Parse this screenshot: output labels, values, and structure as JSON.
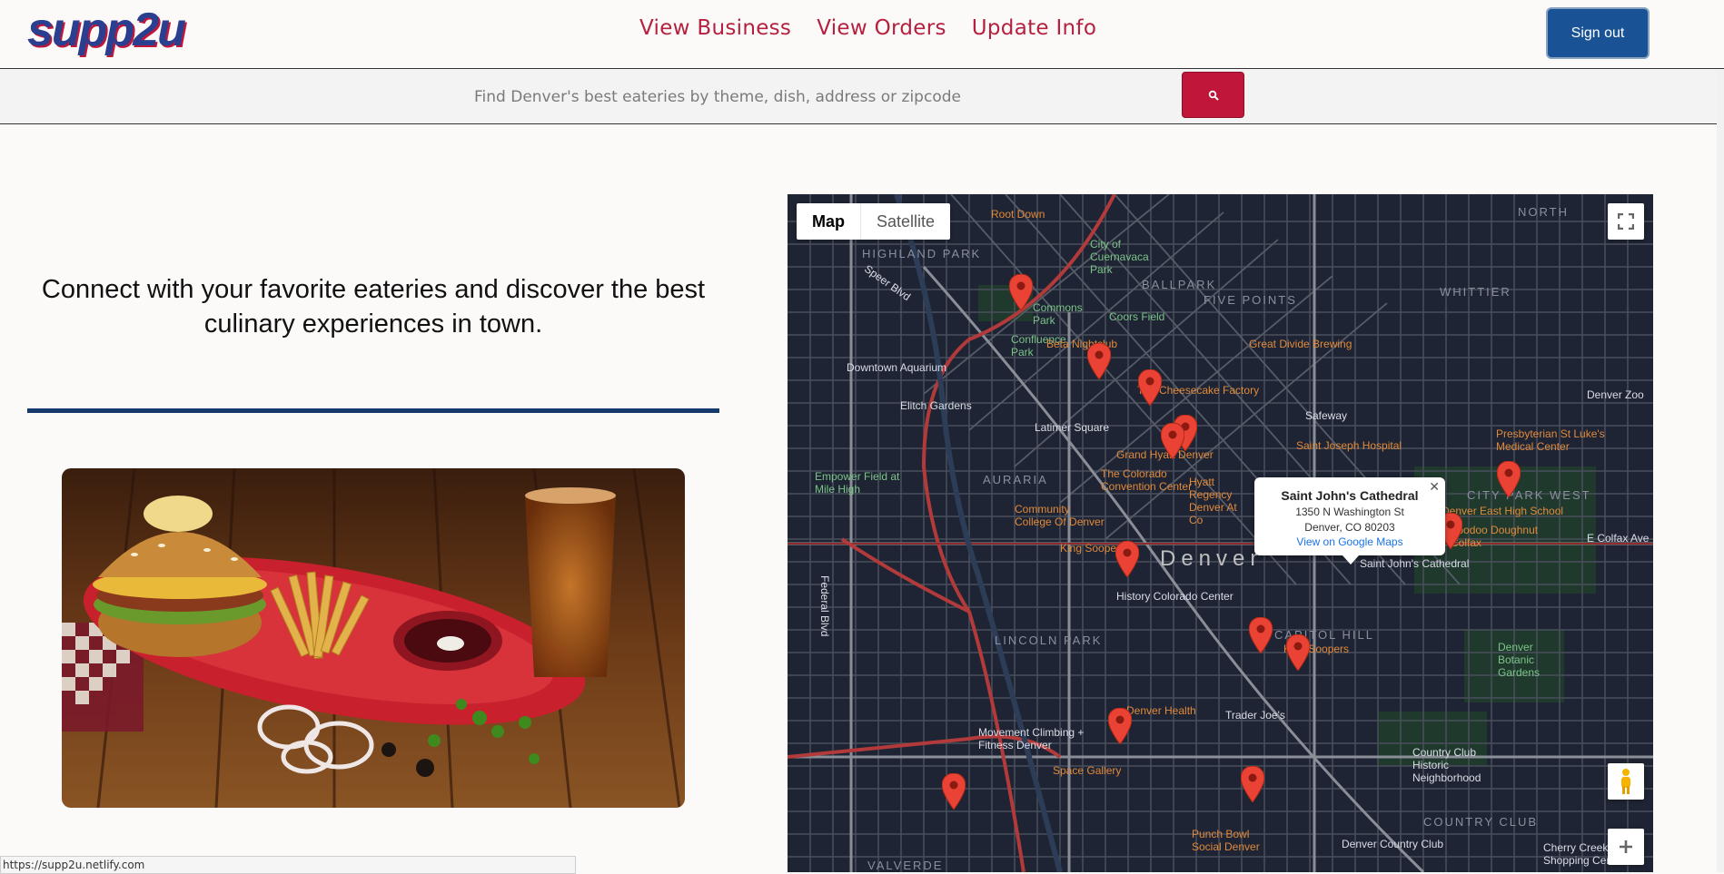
{
  "header": {
    "logo_text": "supp2u",
    "nav": [
      "View Business",
      "View Orders",
      "Update Info"
    ],
    "signout_label": "Sign out"
  },
  "search": {
    "placeholder": "Find Denver's best eateries by theme, dish, address or zipcode"
  },
  "hero": {
    "tagline": "Connect with your favorite eateries and discover the best culinary experiences in town."
  },
  "map": {
    "toggle": {
      "map": "Map",
      "satellite": "Satellite"
    },
    "info": {
      "title": "Saint John's Cathedral",
      "line1": "1350 N Washington St",
      "line2": "Denver, CO 80203",
      "link": "View on Google Maps"
    },
    "labels": {
      "root_down": "Root Down",
      "highland_park": "HIGHLAND PARK",
      "city_cuernavaca": "City of Cuernavaca Park",
      "ballpark": "BALLPARK",
      "five_points": "FIVE POINTS",
      "whittier": "WHITTIER",
      "north": "NORTH",
      "commons_park": "Commons Park",
      "coors_field": "Coors Field",
      "confluence_park": "Confluence Park",
      "beta_nightclub": "Beta Nightclub",
      "great_divide": "Great Divide Brewing",
      "downtown_aquarium": "Downtown Aquarium",
      "cheesecake": "The Cheesecake Factory",
      "elitch": "Elitch Gardens",
      "safeway": "Safeway",
      "latimer": "Latimer Square",
      "grand_hyatt": "Grand Hyatt Denver",
      "st_joseph": "Saint Joseph Hospital",
      "presbyterian": "Presbyterian St Luke's Medical Center",
      "denver_zoo": "Denver Zoo",
      "auraria": "AURARIA",
      "convention_center": "The Colorado Convention Center",
      "hyatt_regency": "Hyatt Regency Denver At Co",
      "city_park_west": "CITY PARK WEST",
      "east_high": "Denver East High School",
      "voodoo": "Voodoo Doughnut Colfax",
      "empower": "Empower Field at Mile High",
      "ccd": "Community College Of Denver",
      "king_soopers1": "King Soopers",
      "denver": "Denver",
      "st_johns": "Saint John's Cathedral",
      "history_colorado": "History Colorado Center",
      "lincoln_park": "LINCOLN PARK",
      "capitol_hill": "CAPITOL HILL",
      "king_soopers2": "King Soopers",
      "botanic": "Denver Botanic Gardens",
      "denver_health": "Denver Health",
      "trader_joes": "Trader Joe's",
      "movement": "Movement Climbing + Fitness Denver",
      "country_club_hist": "Country Club Historic Neighborhood",
      "space_gallery": "Space Gallery",
      "country_club": "COUNTRY CLUB",
      "punch_bowl": "Punch Bowl Social Denver",
      "denver_cc": "Denver Country Club",
      "cherry_creek": "Cherry Creek Shopping Center",
      "valverde": "VALVERDE",
      "federal_blvd": "Federal Blvd",
      "speer_blvd": "Speer Blvd",
      "colfax": "E Colfax Ave"
    }
  },
  "status_bar": {
    "url": "https://supp2u.netlify.com"
  }
}
